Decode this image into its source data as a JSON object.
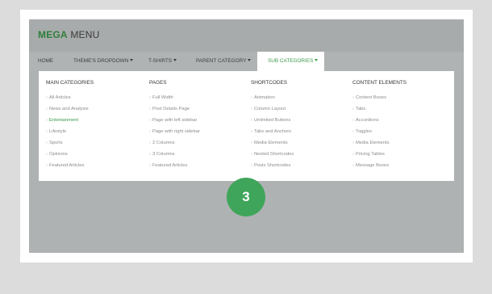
{
  "brand": {
    "strong": "MEGA",
    "rest": "MENU"
  },
  "nav": [
    {
      "label": "HOME",
      "caret": false,
      "active": false
    },
    {
      "label": "THEME'S DROPDOWN",
      "caret": true,
      "active": false
    },
    {
      "label": "T-SHIRTS",
      "caret": true,
      "active": false
    },
    {
      "label": "PARENT CATEGORY",
      "caret": true,
      "active": false
    },
    {
      "label": "SUB CATEGORIES",
      "caret": true,
      "active": true
    }
  ],
  "mega": {
    "columns": [
      {
        "title": "MAIN CATEGORIES",
        "links": [
          "All Articles",
          "News and Analysis",
          "Entertainment",
          "Lifestyle",
          "Sports",
          "Opinions",
          "Featured Articles"
        ],
        "highlight": "Entertainment"
      },
      {
        "title": "PAGES",
        "links": [
          "Full Width",
          "Post Details Page",
          "Page with left sidebar",
          "Page with right sidebar",
          "2 Columns",
          "3 Columns",
          "Featured Articles"
        ]
      },
      {
        "title": "SHORTCODES",
        "links": [
          "Animation",
          "Column Layout",
          "Unlimited Buttons",
          "Tabs and Anchors",
          "Media Elements",
          "Nested Shortcodes",
          "Posts Shortcodes"
        ]
      },
      {
        "title": "CONTENT ELEMENTS",
        "links": [
          "Content Boxes",
          "Tabs",
          "Accordions",
          "Toggles",
          "Media Elements",
          "Pricing Tables",
          "Message Boxes"
        ]
      }
    ]
  },
  "badge": "3",
  "colors": {
    "accent": "#3a9a4a",
    "badge": "#3fa55a",
    "stage": "#afb2b2"
  }
}
